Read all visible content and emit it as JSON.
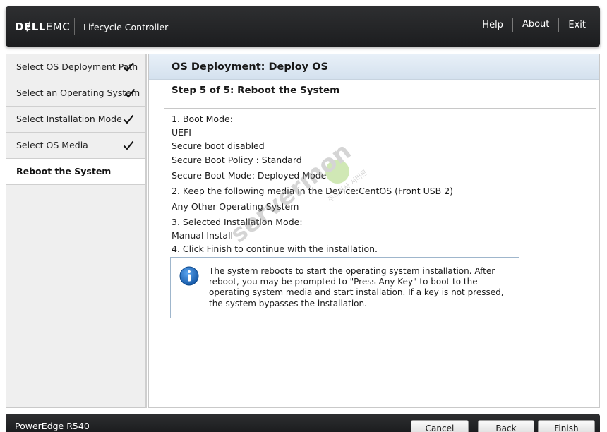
{
  "header": {
    "brand_bold": "DɆLL",
    "brand_light": "EMC",
    "product": "Lifecycle Controller",
    "nav": {
      "help": "Help",
      "about": "About",
      "exit": "Exit"
    }
  },
  "sidebar": {
    "items": [
      {
        "label": "Select OS Deployment Path",
        "completed": true
      },
      {
        "label": "Select an Operating System",
        "completed": true
      },
      {
        "label": "Select Installation Mode",
        "completed": true
      },
      {
        "label": "Select OS Media",
        "completed": true
      },
      {
        "label": "Reboot the System",
        "completed": false,
        "active": true
      }
    ]
  },
  "main": {
    "title": "OS Deployment: Deploy OS",
    "step_title": "Step 5 of 5: Reboot the System",
    "lines": [
      "1. Boot Mode:",
      "UEFI",
      "Secure boot disabled",
      "Secure Boot Policy : Standard",
      "Secure Boot Mode: Deployed Mode",
      "2. Keep the following media in the Device:CentOS (Front USB 2)",
      "Any Other Operating System",
      "3. Selected Installation Mode:",
      "Manual Install",
      "4. Click Finish to continue with the installation."
    ],
    "info": {
      "icon": "info-icon",
      "text": "The system reboots to start the operating system installation. After reboot, you may be prompted to \"Press Any Key\" to boot to the operating system media and start installation. If a key is not pressed, the system bypasses the installation."
    }
  },
  "watermark": {
    "text": "servermon",
    "subtext": "주식회사 서버몬"
  },
  "footer": {
    "model": "PowerEdge R540",
    "buttons": {
      "cancel": "Cancel",
      "back": "Back",
      "finish": "Finish"
    }
  },
  "colors": {
    "header_bg": "#2b2c2e",
    "title_bar_bg": "#dde7f1",
    "info_icon": "#1f6fc0",
    "info_border": "#9fb6cc",
    "watermark_green": "#7bbf2e"
  }
}
